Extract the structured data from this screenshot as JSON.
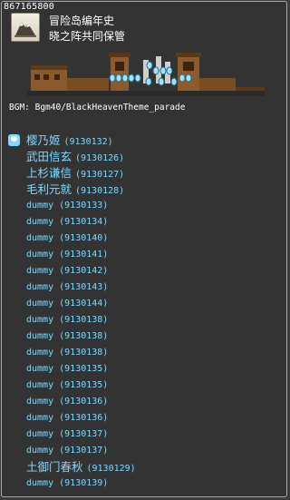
{
  "tooltip": {
    "id": "867165800",
    "street_name": "冒险岛编年史",
    "map_name": "晓之阵共同保管",
    "bgm": "BGM: Bgm40/BlackHeavenTheme_parade"
  },
  "icons": {
    "map": "map-scroll-icon",
    "npc": "npc-marker-icon"
  },
  "colors": {
    "npc_text": "#7fd8ff",
    "background": "#333333",
    "border": "#a8a8a8"
  },
  "npcs": [
    {
      "name": "樱乃姬",
      "id": "(9130132)"
    },
    {
      "name": "武田信玄",
      "id": "(9130126)"
    },
    {
      "name": "上杉谦信",
      "id": "(9130127)"
    },
    {
      "name": "毛利元就",
      "id": "(9130128)"
    },
    {
      "name": "dummy",
      "id": "(9130133)"
    },
    {
      "name": "dummy",
      "id": "(9130134)"
    },
    {
      "name": "dummy",
      "id": "(9130140)"
    },
    {
      "name": "dummy",
      "id": "(9130141)"
    },
    {
      "name": "dummy",
      "id": "(9130142)"
    },
    {
      "name": "dummy",
      "id": "(9130143)"
    },
    {
      "name": "dummy",
      "id": "(9130144)"
    },
    {
      "name": "dummy",
      "id": "(9130138)"
    },
    {
      "name": "dummy",
      "id": "(9130138)"
    },
    {
      "name": "dummy",
      "id": "(9130138)"
    },
    {
      "name": "dummy",
      "id": "(9130135)"
    },
    {
      "name": "dummy",
      "id": "(9130135)"
    },
    {
      "name": "dummy",
      "id": "(9130136)"
    },
    {
      "name": "dummy",
      "id": "(9130136)"
    },
    {
      "name": "dummy",
      "id": "(9130137)"
    },
    {
      "name": "dummy",
      "id": "(9130137)"
    },
    {
      "name": "土御门春秋",
      "id": "(9130129)"
    },
    {
      "name": "dummy",
      "id": "(9130139)"
    }
  ]
}
